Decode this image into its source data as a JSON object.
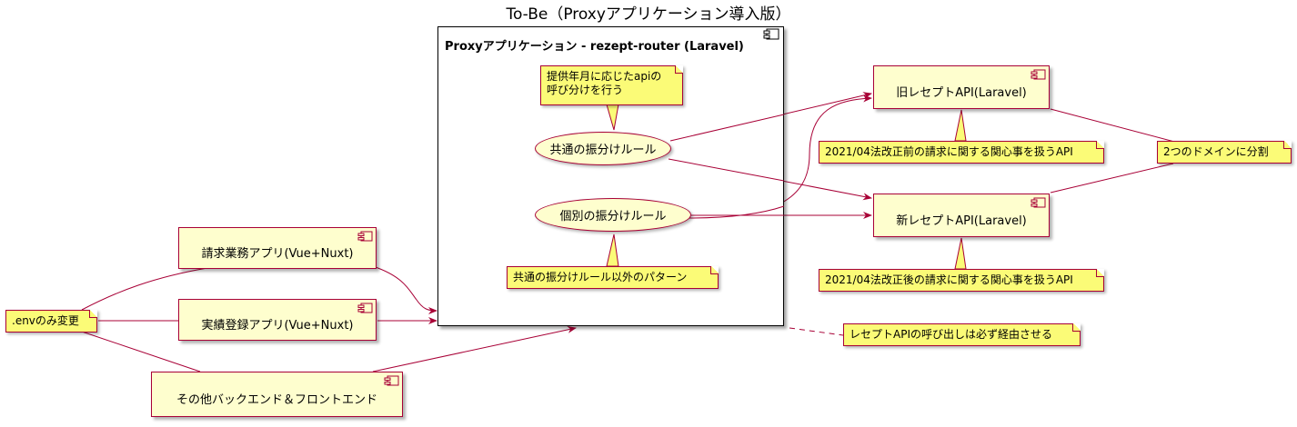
{
  "title": "To-Be（Proxyアプリケーション導入版）",
  "package": {
    "title": "Proxyアプリケーション - rezept-router (Laravel)"
  },
  "usecases": {
    "common": "共通の振分けルール",
    "individual": "個別の振分けルール"
  },
  "components": {
    "old_api": "旧レセプトAPI(Laravel)",
    "new_api": "新レセプトAPI(Laravel)",
    "billing_app": "請求業務アプリ(Vue+Nuxt)",
    "record_app": "実績登録アプリ(Vue+Nuxt)",
    "other": "その他バックエンド＆フロントエンド"
  },
  "notes": {
    "provision": [
      "提供年月に応じたapiの",
      "呼び分けを行う"
    ],
    "other_pattern": "共通の振分けルール以外のパターン",
    "before_reform": "2021/04法改正前の請求に関する関心事を扱うAPI",
    "after_reform": "2021/04法改正後の請求に関する関心事を扱うAPI",
    "split": "2つのドメインに分割",
    "env": ".envのみ変更",
    "via_proxy": "レセプトAPIの呼び出しは必ず経由させる"
  },
  "colors": {
    "component_fill": "#FEFECE",
    "border": "#A80036",
    "note_fill": "#FBFB77"
  }
}
